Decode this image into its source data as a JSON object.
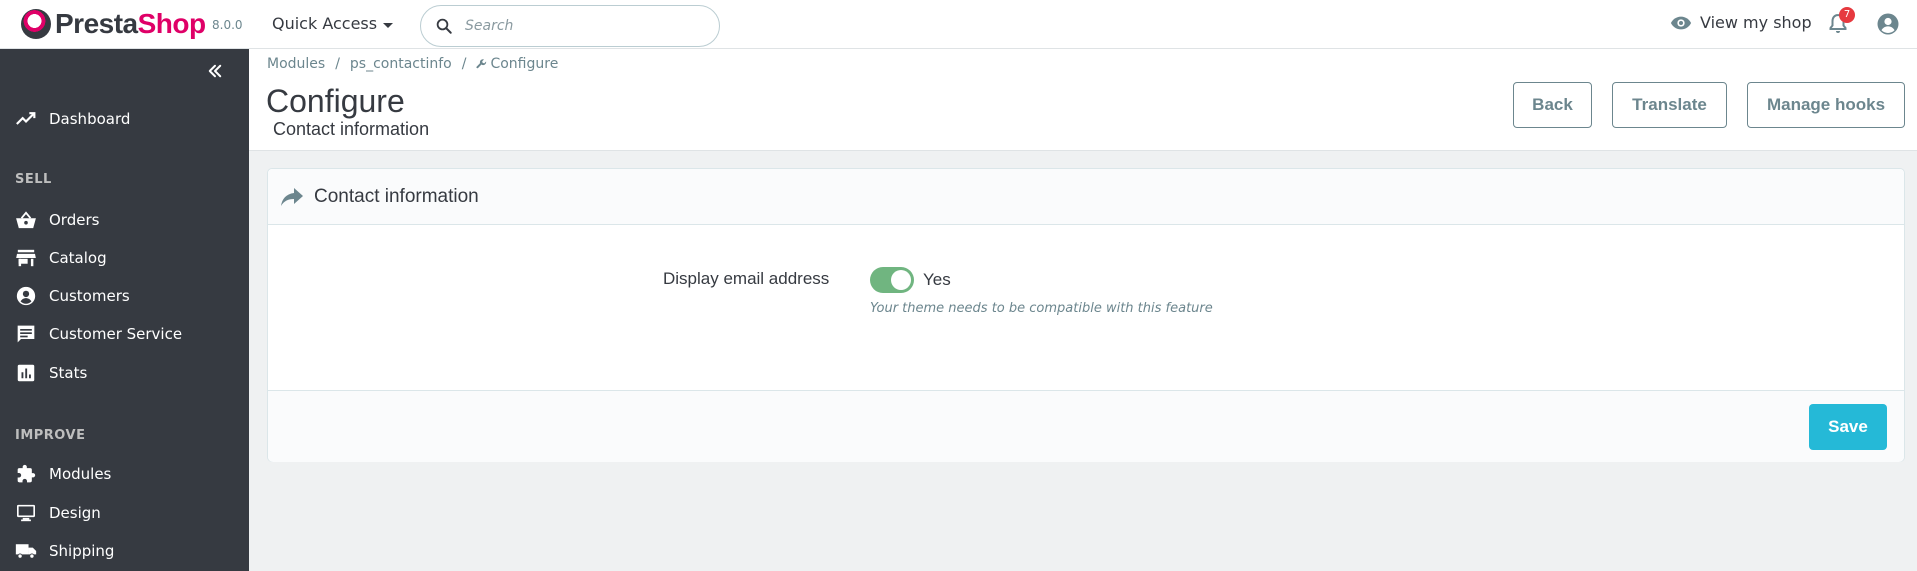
{
  "header": {
    "logo_prefix": "Presta",
    "logo_suffix": "Shop",
    "version": "8.0.0",
    "quick_access": "Quick Access",
    "search_placeholder": "Search",
    "view_shop": "View my shop",
    "notification_count": "7",
    "accent_color": "#df0067"
  },
  "sidebar": {
    "dashboard": "Dashboard",
    "sell_section": "SELL",
    "sell_items": [
      "Orders",
      "Catalog",
      "Customers",
      "Customer Service",
      "Stats"
    ],
    "improve_section": "IMPROVE",
    "improve_items": [
      "Modules",
      "Design",
      "Shipping"
    ]
  },
  "page": {
    "breadcrumb": [
      "Modules",
      "ps_contactinfo",
      "Configure"
    ],
    "breadcrumb_separator": "/",
    "title": "Configure",
    "subtitle": "Contact information",
    "buttons": {
      "back": "Back",
      "translate": "Translate",
      "manage_hooks": "Manage hooks"
    }
  },
  "panel": {
    "title": "Contact information",
    "field_label": "Display email address",
    "toggle_value": "Yes",
    "toggle_on": true,
    "help_text": "Your theme needs to be compatible with this feature",
    "save_label": "Save",
    "save_color": "#25b9d7",
    "toggle_color": "#70b580"
  }
}
